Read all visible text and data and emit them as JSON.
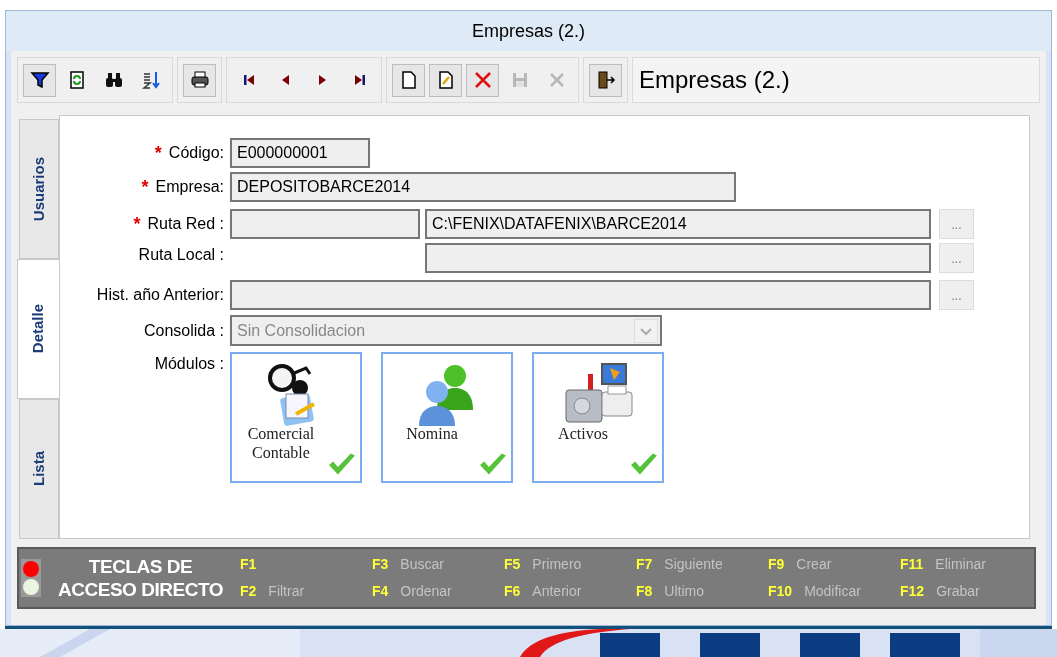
{
  "window": {
    "title": "Empresas (2.)"
  },
  "toolbar": {
    "groups": [
      [
        {
          "kind": "filter",
          "disabled": false
        },
        {
          "kind": "refresh",
          "disabled": false
        },
        {
          "kind": "find",
          "disabled": false
        },
        {
          "kind": "sort",
          "disabled": false
        }
      ],
      [
        {
          "kind": "print",
          "disabled": false
        }
      ],
      [
        {
          "kind": "first",
          "disabled": false
        },
        {
          "kind": "prev",
          "disabled": false
        },
        {
          "kind": "next",
          "disabled": false
        },
        {
          "kind": "last",
          "disabled": false
        }
      ],
      [
        {
          "kind": "new",
          "disabled": false
        },
        {
          "kind": "edit",
          "disabled": false
        },
        {
          "kind": "delete",
          "disabled": false
        },
        {
          "kind": "save",
          "disabled": true
        },
        {
          "kind": "cancel",
          "disabled": true
        }
      ],
      [
        {
          "kind": "exit",
          "disabled": false
        }
      ]
    ],
    "title": "Empresas (2.)"
  },
  "tabs": [
    {
      "label": "Usuarios",
      "selected": false
    },
    {
      "label": "Detalle",
      "selected": true
    },
    {
      "label": "Lista",
      "selected": false
    }
  ],
  "form": {
    "fields": [
      {
        "kind": "short",
        "required_mark": "*",
        "label": "Código:",
        "value": "E000000001"
      },
      {
        "kind": "medium",
        "required_mark": "*",
        "label": "Empresa:",
        "value": "DEPOSITOBARCE2014"
      },
      {
        "kind": "split",
        "required_mark": "*",
        "label": "Ruta Red :",
        "value": "C:\\FENIX\\DATAFENIX\\BARCE2014",
        "browse": "..."
      },
      {
        "kind": "right",
        "label": "Ruta Local :",
        "browse": "..."
      },
      {
        "kind": "long",
        "label": "Hist. año Anterior:",
        "browse": "..."
      },
      {
        "kind": "select",
        "label": "Consolida :",
        "value": "Sin Consolidacion",
        "disabled": true
      }
    ],
    "modules": {
      "label": "Módulos :",
      "items": [
        {
          "kind": "commerce",
          "name": "Comercial Contable",
          "checked": true
        },
        {
          "kind": "payroll",
          "name": "Nomina",
          "checked": true
        },
        {
          "kind": "assets",
          "name": "Activos",
          "checked": true
        }
      ]
    }
  },
  "shortcuts": {
    "title_lines": [
      "TECLAS DE",
      "ACCESO DIRECTO"
    ],
    "lights": [
      {
        "color": "#ff0000"
      },
      {
        "color": "#eaf5e2"
      }
    ],
    "keys": [
      {
        "key": "F1"
      },
      {
        "key": "F2",
        "label": "Filtrar"
      },
      {
        "key": "F3",
        "label": "Buscar"
      },
      {
        "key": "F4",
        "label": "Ordenar"
      },
      {
        "key": "F5",
        "label": "Primero"
      },
      {
        "key": "F6",
        "label": "Anterior"
      },
      {
        "key": "F7",
        "label": "Siguiente"
      },
      {
        "key": "F8",
        "label": "Ultimo"
      },
      {
        "key": "F9",
        "label": "Crear"
      },
      {
        "key": "F10",
        "label": "Modificar"
      },
      {
        "key": "F11",
        "label": "Eliminar"
      },
      {
        "key": "F12",
        "label": "Grabar"
      }
    ]
  }
}
